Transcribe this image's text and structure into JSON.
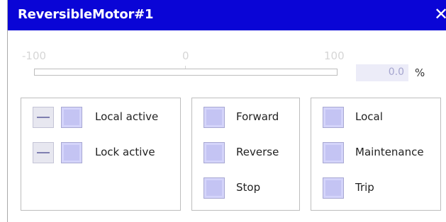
{
  "window": {
    "title": "ReversibleMotor#1",
    "close_glyph": "✕"
  },
  "scale": {
    "ticks": [
      "-100",
      "0",
      "100"
    ],
    "value": "0.0",
    "unit": "%",
    "fill_fraction": 0.5,
    "accent_color": "#0a05d6"
  },
  "groups": {
    "left": {
      "items": [
        {
          "label": "Local active"
        },
        {
          "label": "Lock active"
        }
      ]
    },
    "middle": {
      "items": [
        {
          "label": "Forward"
        },
        {
          "label": "Reverse"
        },
        {
          "label": "Stop"
        }
      ]
    },
    "right": {
      "items": [
        {
          "label": "Local"
        },
        {
          "label": "Maintenance"
        },
        {
          "label": "Trip"
        }
      ]
    }
  }
}
